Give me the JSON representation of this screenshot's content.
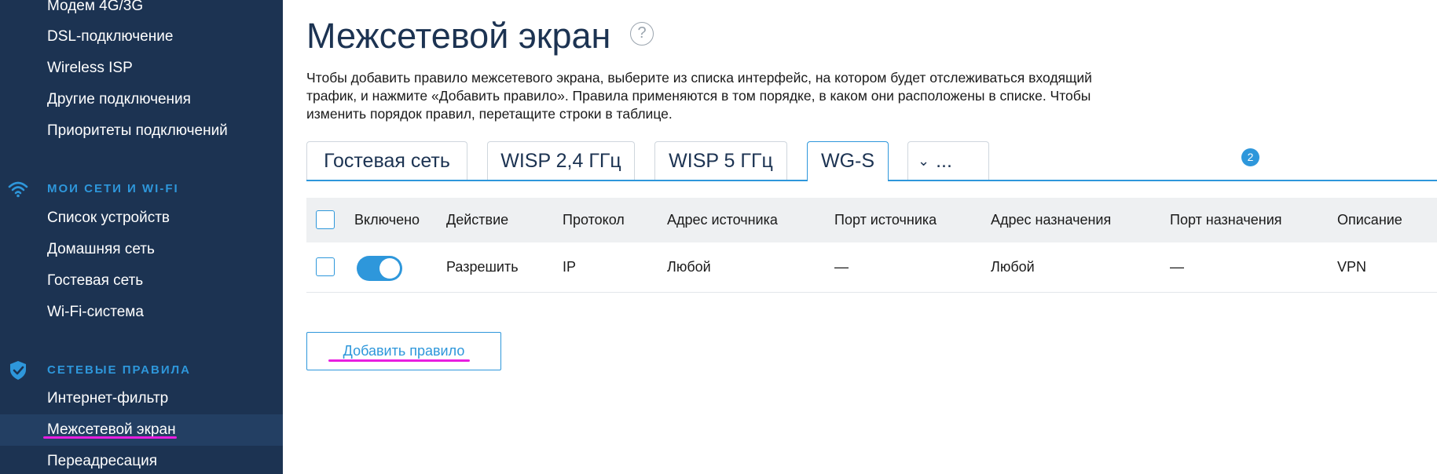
{
  "sidebar": {
    "items_top": [
      {
        "label": "Модем 4G/3G"
      },
      {
        "label": "DSL-подключение"
      },
      {
        "label": "Wireless ISP"
      },
      {
        "label": "Другие подключения"
      },
      {
        "label": "Приоритеты подключений"
      }
    ],
    "section_networks": {
      "title": "МОИ СЕТИ И WI-FI",
      "icon": "wifi-icon",
      "items": [
        {
          "label": "Список устройств"
        },
        {
          "label": "Домашняя сеть"
        },
        {
          "label": "Гостевая сеть"
        },
        {
          "label": "Wi-Fi-система"
        }
      ]
    },
    "section_rules": {
      "title": "СЕТЕВЫЕ ПРАВИЛА",
      "icon": "shield-check-icon",
      "items": [
        {
          "label": "Интернет-фильтр"
        },
        {
          "label": "Межсетевой экран",
          "active": true
        },
        {
          "label": "Переадресация"
        }
      ]
    }
  },
  "main": {
    "title": "Межсетевой экран",
    "help_icon": "?",
    "description": "Чтобы добавить правило межсетевого экрана, выберите из списка интерфейс, на котором будет отслеживаться входящий трафик, и нажмите «Добавить правило». Правила применяются в том порядке, в каком они расположены в списке. Чтобы изменить порядок правил, перетащите строки в таблице.",
    "tabs": [
      {
        "label": "Гостевая сеть"
      },
      {
        "label": "WISP 2,4 ГГц"
      },
      {
        "label": "WISP 5 ГГц"
      },
      {
        "label": "WG-S",
        "active": true
      },
      {
        "label": "...",
        "chevron": "⌄",
        "badge": "2"
      }
    ],
    "table": {
      "headers": {
        "enabled": "Включено",
        "action": "Действие",
        "protocol": "Протокол",
        "src_addr": "Адрес источника",
        "src_port": "Порт источника",
        "dst_addr": "Адрес назначения",
        "dst_port": "Порт назначения",
        "description": "Описание"
      },
      "rows": [
        {
          "enabled": true,
          "action": "Разрешить",
          "protocol": "IP",
          "src_addr": "Любой",
          "src_port": "—",
          "dst_addr": "Любой",
          "dst_port": "—",
          "description": "VPN"
        }
      ]
    },
    "add_button": "Добавить правило"
  },
  "colors": {
    "sidebar_bg": "#1c3352",
    "sidebar_active_bg": "#233f63",
    "accent": "#2e97db",
    "highlight_mark": "#e81ee0",
    "table_header_bg": "#eef0f2"
  }
}
